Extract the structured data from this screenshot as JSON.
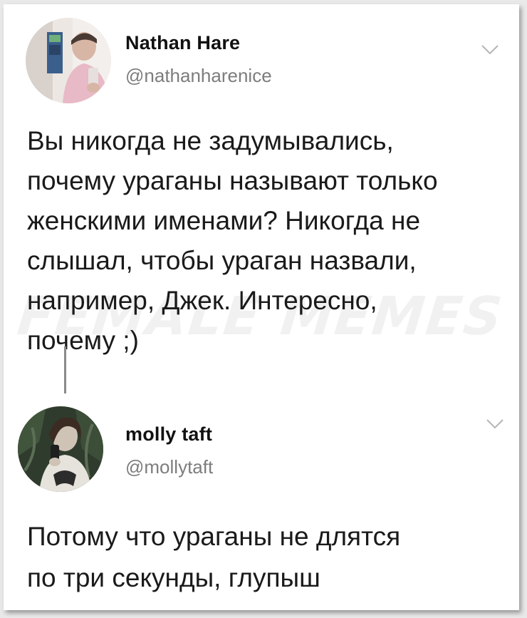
{
  "watermark_text": "FEMALE MEMES",
  "tweets": [
    {
      "name": "Nathan Hare",
      "handle": "@nathanharenice",
      "text": "Вы никогда не задумывались,\nпочему ураганы называют только\nженскими именами? Никогда не\nслышал, чтобы ураган назвали,\nнапример, Джек. Интересно,\nпочему ;)",
      "menu_icon": "chevron-down-icon"
    },
    {
      "name": "molly taft",
      "handle": "@mollytaft",
      "text": "Потому что ураганы не  длятся\nпо три секунды,  глупыш",
      "menu_icon": "chevron-down-icon"
    }
  ],
  "colors": {
    "text": "#1a1a1a",
    "handle": "#7d7d7d",
    "thread_line": "#8a8a8a",
    "chevron": "#b5b5b5"
  }
}
